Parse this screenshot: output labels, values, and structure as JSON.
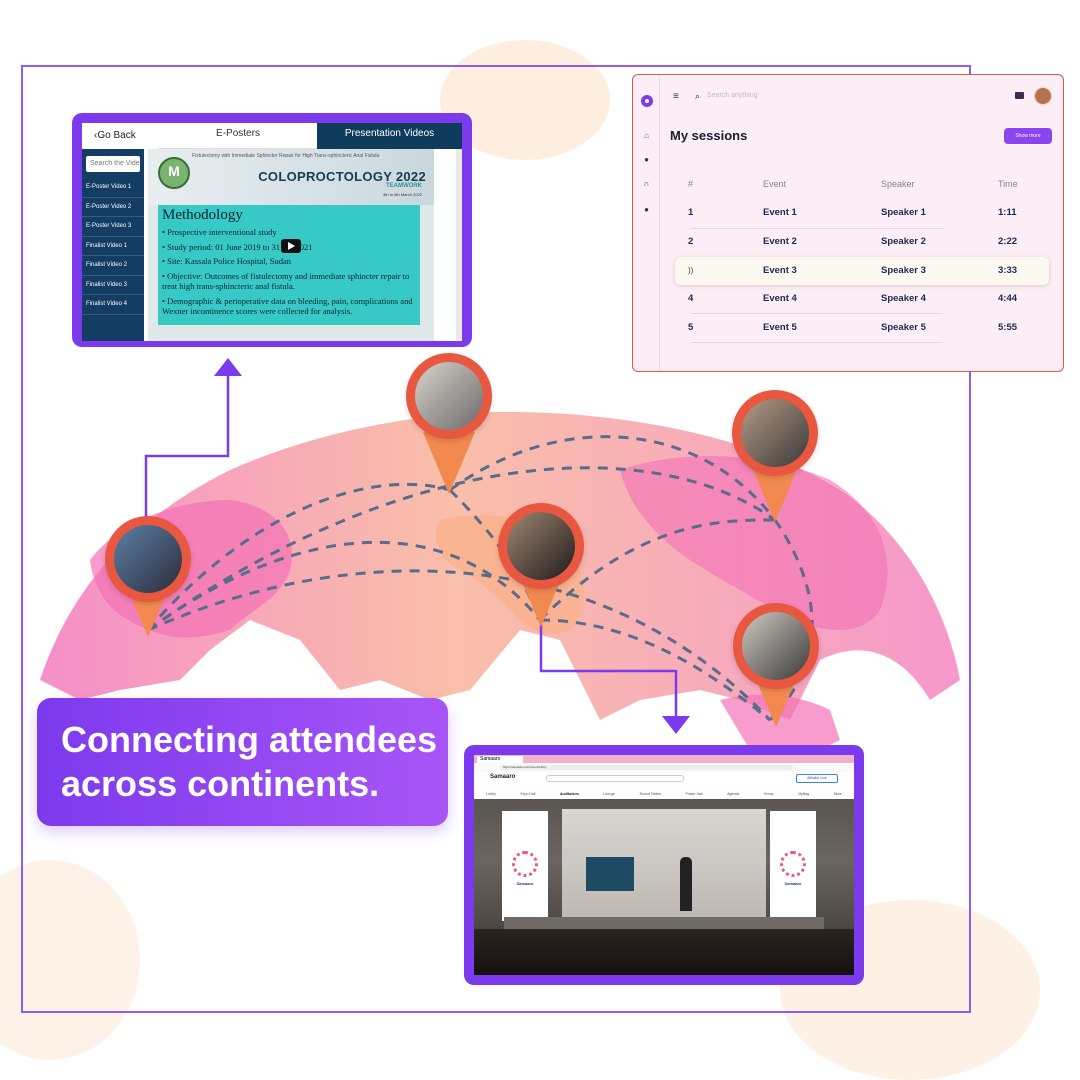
{
  "colors": {
    "brand": "#7c3aed",
    "pin": "#e8573f",
    "map": "#f28cb9",
    "sessions_border": "#e0574b",
    "route": "#596c8a"
  },
  "eposter": {
    "back_label": "Go Back",
    "tab_eposters": "E-Posters",
    "tab_videos": "Presentation Videos",
    "search_placeholder": "Search the Vide",
    "items": [
      "E-Poster Video 1",
      "E-Poster Video 2",
      "E-Poster Video 3",
      "Finalist Video 1",
      "Finalist Video 2",
      "Finalist Video 3",
      "Finalist Video 4"
    ],
    "slide": {
      "logo_letter": "M",
      "subtitle": "Fistulectomy with Immediate Sphincter Repair for High Trans-sphincteric Anal Fistula",
      "conference": "COLOPROCTOLOGY 2022",
      "team": "TEAMWORK",
      "date": "4th to 6th March 2022",
      "heading": "Methodology",
      "bullets": [
        "• Prospective interventional study",
        "• Study period: 01 June 2019 to 31 Jan 2021",
        "• Site: Kassala Police Hospital, Sudan",
        "• Objective: Outcomes of fistulectomy and immediate sphincter repair to treat high trans-sphincteric anal fistula.",
        "• Demographic & perioperative data on bleeding, pain, complications and Wexner incontinence scores were collected for analysis."
      ]
    }
  },
  "sessions": {
    "search_placeholder": "Search anything",
    "title": "My sessions",
    "show_more": "Show more",
    "columns": [
      "#",
      "Event",
      "Speaker",
      "Time"
    ],
    "rows": [
      {
        "num": "1",
        "event": "Event 1",
        "speaker": "Speaker 1",
        "time": "1:11"
      },
      {
        "num": "2",
        "event": "Event 2",
        "speaker": "Speaker 2",
        "time": "2:22"
      },
      {
        "num": "",
        "event": "Event 3",
        "speaker": "Speaker 3",
        "time": "3:33"
      },
      {
        "num": "4",
        "event": "Event 4",
        "speaker": "Speaker 4",
        "time": "4:44"
      },
      {
        "num": "5",
        "event": "Event 5",
        "speaker": "Speaker 5",
        "time": "5:55"
      }
    ],
    "live_indicator": "))"
  },
  "caption": {
    "line1": "Connecting attendees",
    "line2": "across continents."
  },
  "auditorium": {
    "tab_label": "Samaaro",
    "url": "https://samaaro.com/event/lobby",
    "brand": "Samaaro",
    "badge": "AiBuildr Live",
    "menu": [
      "Lobby",
      "Expo Hall",
      "Auditorium",
      "Lounge",
      "Round Tables",
      "Poster Hall",
      "Agenda",
      "Group",
      "MyBag",
      "More"
    ],
    "banner_text": "Samaaro"
  }
}
